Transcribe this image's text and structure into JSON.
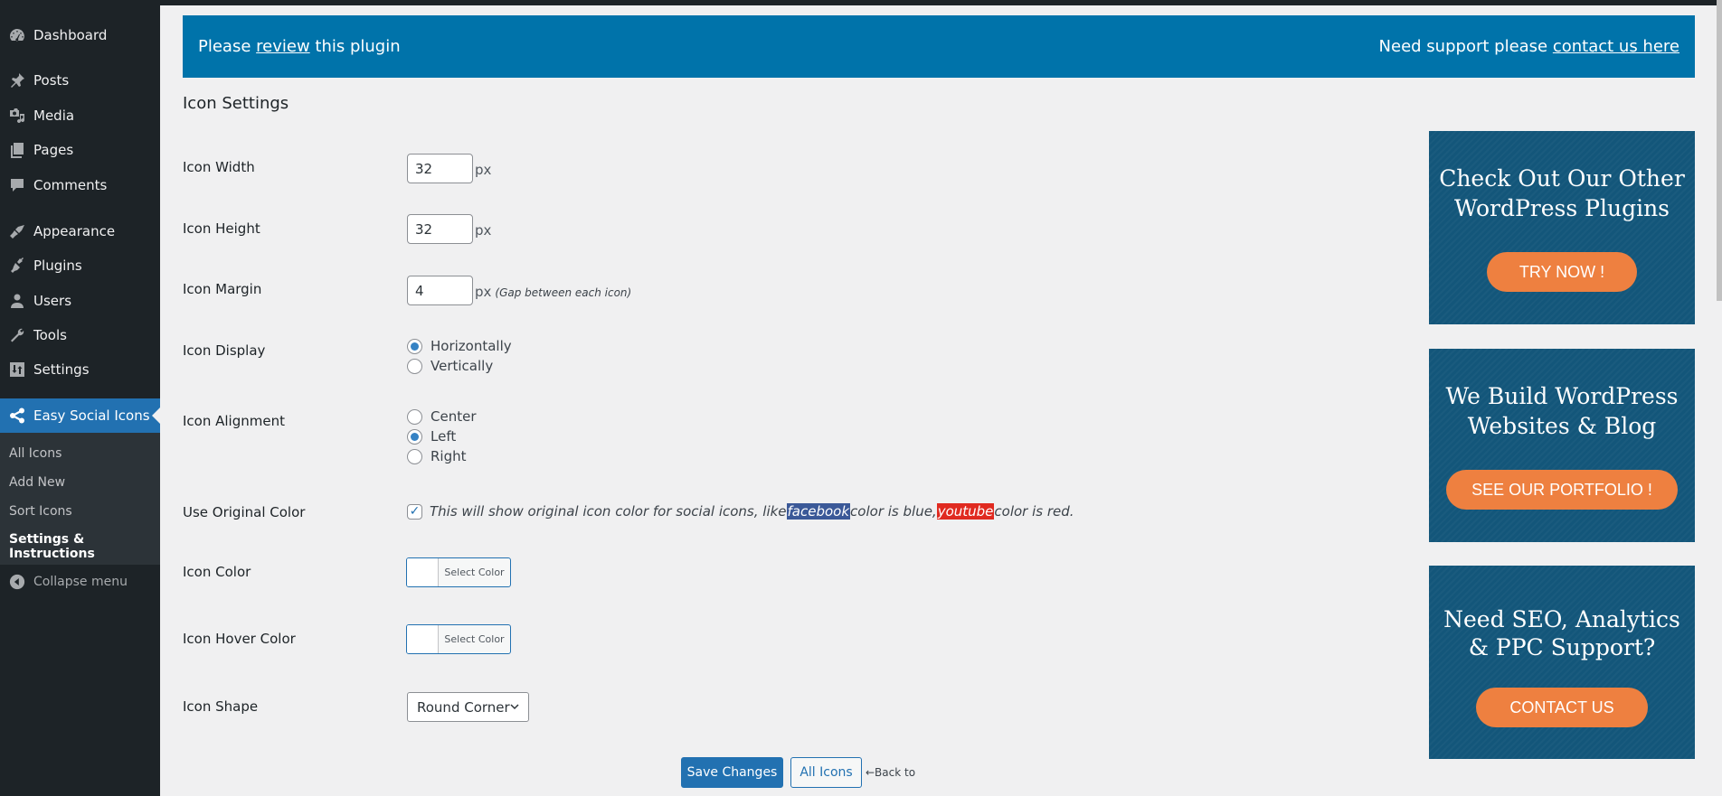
{
  "sidebar": {
    "items": [
      {
        "label": "Dashboard",
        "icon": "dashboard-icon"
      },
      {
        "label": "Posts",
        "icon": "pin-icon"
      },
      {
        "label": "Media",
        "icon": "media-icon"
      },
      {
        "label": "Pages",
        "icon": "pages-icon"
      },
      {
        "label": "Comments",
        "icon": "comment-icon"
      },
      {
        "label": "Appearance",
        "icon": "paintbrush-icon"
      },
      {
        "label": "Plugins",
        "icon": "plug-icon"
      },
      {
        "label": "Users",
        "icon": "user-icon"
      },
      {
        "label": "Tools",
        "icon": "wrench-icon"
      },
      {
        "label": "Settings",
        "icon": "sliders-icon"
      },
      {
        "label": "Easy Social Icons",
        "icon": "share-icon",
        "active": true
      }
    ],
    "submenu": [
      {
        "label": "All Icons"
      },
      {
        "label": "Add New"
      },
      {
        "label": "Sort Icons"
      },
      {
        "label": "Settings & Instructions",
        "current": true
      }
    ],
    "collapse_label": "Collapse menu"
  },
  "banner": {
    "left_prefix": "Please ",
    "left_link": "review",
    "left_suffix": " this plugin",
    "right_prefix": "Need support please ",
    "right_link": "contact us here",
    "color": "#0073aa"
  },
  "section_title": "Icon Settings",
  "form": {
    "icon_width": {
      "label": "Icon Width",
      "value": "32",
      "unit": "px"
    },
    "icon_height": {
      "label": "Icon Height",
      "value": "32",
      "unit": "px"
    },
    "icon_margin": {
      "label": "Icon Margin",
      "value": "4",
      "unit": "px",
      "hint": "(Gap between each icon)"
    },
    "icon_display": {
      "label": "Icon Display",
      "options": [
        "Horizontally",
        "Vertically"
      ],
      "selected": "Horizontally"
    },
    "icon_alignment": {
      "label": "Icon Alignment",
      "options": [
        "Center",
        "Left",
        "Right"
      ],
      "selected": "Left"
    },
    "original_color": {
      "label": "Use Original Color",
      "checked": true,
      "text_before": "This will show original icon color for social icons, like ",
      "facebook": "facebook",
      "text_middle": " color is blue, ",
      "youtube": "youtube",
      "text_after": " color is red.",
      "facebook_color": "#3b5998",
      "youtube_color": "#e02a20"
    },
    "icon_color": {
      "label": "Icon Color",
      "button": "Select Color"
    },
    "icon_hover_color": {
      "label": "Icon Hover Color",
      "button": "Select Color"
    },
    "icon_shape": {
      "label": "Icon Shape",
      "selected": "Round Corner"
    }
  },
  "actions": {
    "save": "Save Changes",
    "all_icons": "All Icons",
    "back_to": "←Back to"
  },
  "ads": [
    {
      "title_line1": "Check Out Our Other",
      "title_line2": "WordPress Plugins",
      "button": "TRY NOW !"
    },
    {
      "title_line1": "We Build WordPress",
      "title_line2": "Websites & Blog",
      "button": "SEE OUR PORTFOLIO !"
    },
    {
      "title_line1": "Need SEO, Analytics",
      "title_line2": "& PPC Support?",
      "button": "CONTACT US"
    }
  ]
}
